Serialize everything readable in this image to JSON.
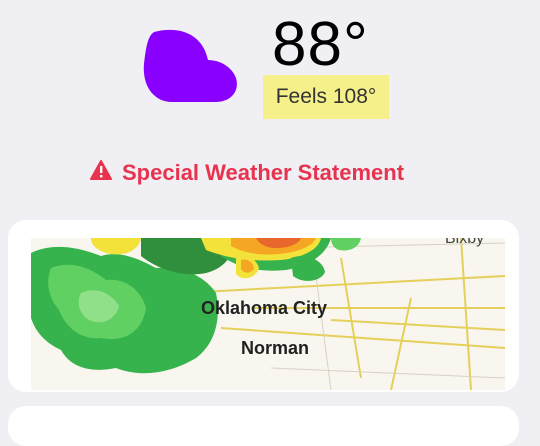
{
  "current": {
    "temperature": "88°",
    "feels_like": "Feels 108°",
    "condition_icon": "cloud-icon",
    "icon_color": "#8a00ff"
  },
  "alert": {
    "text": "Special Weather Statement",
    "icon": "warning-icon",
    "color": "#e8334f"
  },
  "radar_map": {
    "labels": [
      "Bixby",
      "Oklahoma City",
      "Norman"
    ]
  }
}
